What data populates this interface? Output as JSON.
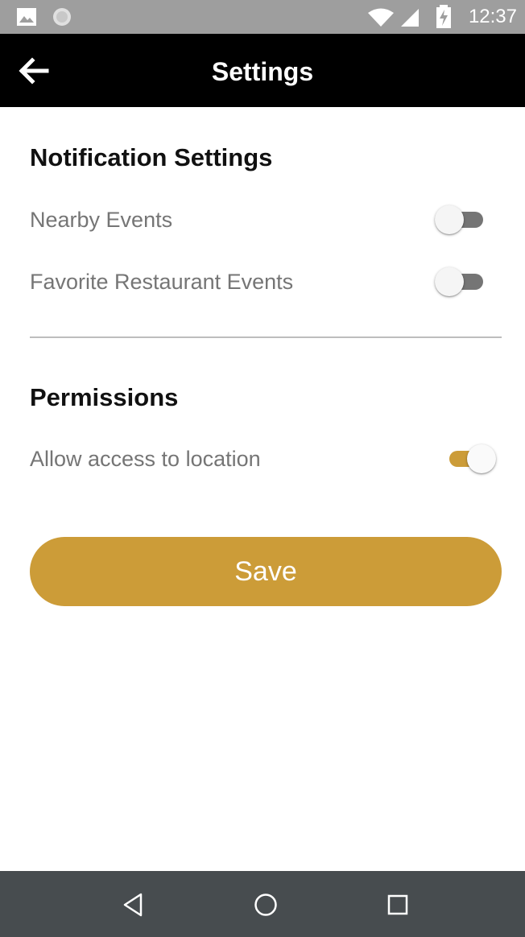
{
  "status_bar": {
    "time": "12:37",
    "icons": [
      "image-icon",
      "circle-notification-icon",
      "wifi-icon",
      "cell-signal-icon",
      "battery-charging-icon"
    ]
  },
  "app_bar": {
    "title": "Settings",
    "back_icon": "arrow-left-icon"
  },
  "notification_settings": {
    "title": "Notification Settings",
    "items": [
      {
        "label": "Nearby Events",
        "enabled": false
      },
      {
        "label": "Favorite Restaurant Events",
        "enabled": false
      }
    ]
  },
  "permissions": {
    "title": "Permissions",
    "items": [
      {
        "label": "Allow access to location",
        "enabled": true
      }
    ]
  },
  "save_button": {
    "label": "Save"
  },
  "nav_bar": {
    "icons": [
      "back-triangle-icon",
      "home-circle-icon",
      "recents-square-icon"
    ]
  },
  "colors": {
    "accent": "#cc9c38",
    "app_bar": "#000000",
    "status_bar": "#9e9e9e",
    "nav_bar": "#474c4f",
    "toggle_off_track": "#757575"
  }
}
